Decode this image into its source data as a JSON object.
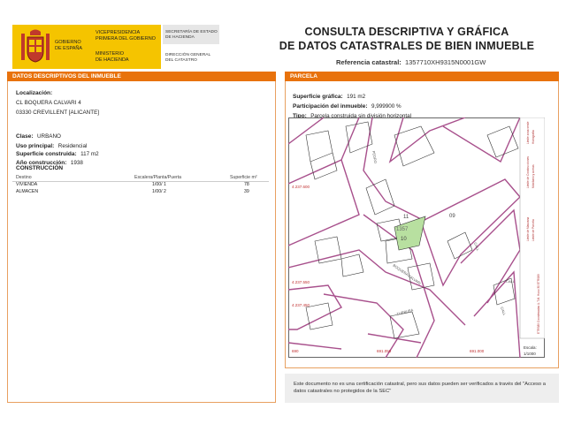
{
  "header": {
    "gobierno": [
      "GOBIERNO",
      "DE ESPAÑA"
    ],
    "vicepresidencia": [
      "VICEPRESIDENCIA",
      "PRIMERA DEL GOBIERNO"
    ],
    "ministerio": [
      "MINISTERIO",
      "DE HACIENDA"
    ],
    "secretaria": [
      "SECRETARÍA DE ESTADO",
      "DE HACIENDA"
    ],
    "direccion": [
      "DIRECCIÓN GENERAL",
      "DEL CATASTRO"
    ],
    "title_line1": "CONSULTA DESCRIPTIVA Y GRÁFICA",
    "title_line2": "DE DATOS CATASTRALES DE BIEN INMUEBLE",
    "ref_label": "Referencia catastral:",
    "ref_value": "1357710XH9315N0001GW"
  },
  "left": {
    "section_title": "DATOS DESCRIPTIVOS DEL INMUEBLE",
    "localizacion_label": "Localización:",
    "address_line1": "CL BOQUERA CALVARI 4",
    "address_line2": "03330 CREVILLENT [ALICANTE]",
    "clase_label": "Clase:",
    "clase_value": "URBANO",
    "uso_label": "Uso principal:",
    "uso_value": "Residencial",
    "sup_label": "Superficie construida:",
    "sup_value": "117 m2",
    "anio_label": "Año construcción:",
    "anio_value": "1938",
    "construccion_title": "CONSTRUCCIÓN",
    "table_headers": [
      "Destino",
      "Escalera/Planta/Puerta",
      "Superficie m²"
    ],
    "rows": [
      [
        "VIVIENDA",
        "1/00/ 1",
        "78"
      ],
      [
        "ALMACEN",
        "1/00/ 2",
        "39"
      ]
    ]
  },
  "right": {
    "section_title": "PARCELA",
    "sup_grafica_label": "Superficie gráfica:",
    "sup_grafica_value": "191 m2",
    "participacion_label": "Participación del inmueble:",
    "participacion_value": "9,999900 %",
    "tipo_label": "Tipo:",
    "tipo_value": "Parcela construida sin división horizontal",
    "map": {
      "coord_top": "4.237.600",
      "coord_mid": "4.237.550",
      "coord_low": "4.237.450",
      "coord_bottom": [
        "690",
        "691.050",
        "691.000"
      ],
      "parcel_numbers": [
        "11",
        "09",
        "10",
        "1357"
      ],
      "street_labels": [
        "BOQUERA CALVARI",
        "TURBUSA",
        "CALL",
        "CALL",
        "CALL",
        "PEDRO"
      ],
      "legend": [
        "Límite de Manzana",
        "Límite de Parcela",
        "Límite de Construcciones",
        "Mobiliario y aceras",
        "Límite zona verde",
        "Hidrografía"
      ],
      "scale_label": "Escala:",
      "scale_value": "1/1000",
      "projection_note": "ETRS89 Coordenadas U.T.M. Huso 30 ETRS89"
    },
    "disclaimer": "Este documento no es una certificación catastral, pero sus datos pueden ser verificados a través del \"Acceso a datos catastrales no protegidos de la SEC\""
  },
  "colors": {
    "accent": "#e8720c",
    "plot_pink": "#a8508c",
    "parcel_green": "#b8e0a0",
    "logo_yellow": "#f5c400"
  }
}
